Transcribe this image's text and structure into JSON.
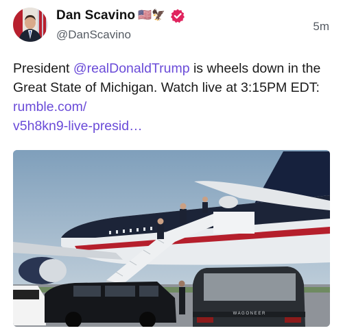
{
  "author": {
    "display_name": "Dan Scavino",
    "name_emojis": "🇺🇸🦅",
    "handle": "@DanScavino",
    "verified": true
  },
  "timestamp": "5m",
  "post": {
    "text_before_mention": "President ",
    "mention": "@realDonaldTrump",
    "text_after_mention": " is wheels down in the Great State of Michigan. Watch live at 3:15PM EDT: ",
    "link_line1": "rumble.com/",
    "link_line2": "v5h8kn9-live-presid…"
  },
  "media": {
    "kind": "photo",
    "vehicle_grille_text": "W A G O N E E R"
  },
  "colors": {
    "mention": "#6a4bd8",
    "verified_badge": "#e0245e",
    "secondary_text": "#555b63"
  }
}
